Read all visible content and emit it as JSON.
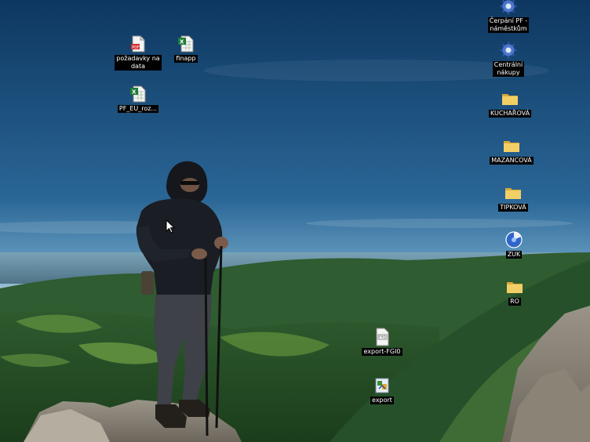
{
  "desktop": {
    "icons_left": [
      {
        "name": "požadavky na\ndata",
        "icon": "pdf-document-icon"
      },
      {
        "name": "finapp",
        "icon": "excel-file-icon"
      },
      {
        "name": "PF_EU_roz...",
        "icon": "excel-file-icon"
      }
    ],
    "icons_right": [
      {
        "name": "Čerpání PF -\nnáměstkům",
        "icon": "shortcut-gear-icon"
      },
      {
        "name": "Centrální\nnákupy",
        "icon": "shortcut-gear-icon"
      },
      {
        "name": "KUCHAŘOVÁ",
        "icon": "folder-icon"
      },
      {
        "name": "MAZANCOVÁ",
        "icon": "folder-icon"
      },
      {
        "name": "TIPKOVÁ",
        "icon": "folder-icon"
      },
      {
        "name": "ZUK",
        "icon": "blue-disk-icon"
      },
      {
        "name": "RO",
        "icon": "folder-icon"
      }
    ],
    "icons_bottom": [
      {
        "name": "export-FGI0",
        "icon": "fxd-file-icon"
      },
      {
        "name": "export",
        "icon": "export-app-icon"
      }
    ],
    "colors": {
      "sky_top": "#0f3a66",
      "sky_bottom": "#4f8fb6",
      "hills": "#2c5a2a",
      "label_bg": "#000000",
      "folder": "#e9c45b"
    }
  }
}
